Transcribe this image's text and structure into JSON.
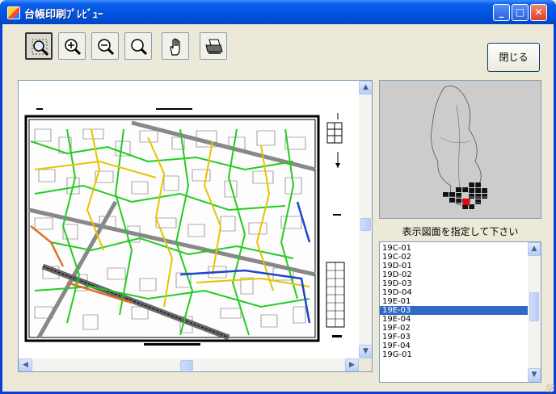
{
  "window": {
    "title": "台帳印刷ﾌﾟﾚﾋﾞｭｰ"
  },
  "toolbar": {
    "tools": [
      {
        "name": "select-zoom",
        "icon": "zoom-area-icon",
        "active": true
      },
      {
        "name": "zoom-in",
        "icon": "zoom-in-icon",
        "active": false
      },
      {
        "name": "zoom-out",
        "icon": "zoom-out-icon",
        "active": false
      },
      {
        "name": "zoom",
        "icon": "magnifier-icon",
        "active": false
      },
      {
        "name": "pan",
        "icon": "hand-icon",
        "active": false
      },
      {
        "name": "print",
        "icon": "printer-icon",
        "active": false
      }
    ],
    "close_label": "閉じる"
  },
  "side": {
    "instruction": "表示図面を指定して下さい",
    "sheets": [
      "19C-01",
      "19C-02",
      "19D-01",
      "19D-02",
      "19D-03",
      "19D-04",
      "19E-01",
      "19E-03",
      "19E-04",
      "19F-02",
      "19F-03",
      "19F-04",
      "19G-01"
    ],
    "selected": "19E-03"
  },
  "colors": {
    "titlebar": "#0053e1",
    "selection": "#316ac5",
    "road_green": "#22cc22",
    "road_yellow": "#e6c400",
    "road_blue": "#2244cc",
    "road_orange": "#e07020"
  }
}
